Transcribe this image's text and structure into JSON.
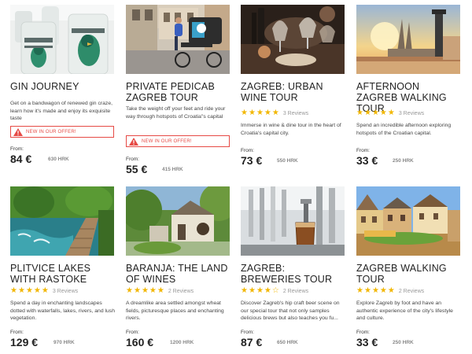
{
  "cards": [
    {
      "title": "GIN JOURNEY",
      "description": "Get on a bandwagon of renewed gin craze, learn how it's made and enjoy its exquisite taste",
      "badge": "NEW IN OUR OFFER!",
      "rating": 0,
      "reviews": "",
      "from_label": "From:",
      "price": "84 €",
      "old_price": "630 HRK",
      "image": "gin-bottles-photo"
    },
    {
      "title": "PRIVATE PEDICAB ZAGREB TOUR",
      "description": "Take the weight off your feet and ride your way through hotspots of Croatia\"s capital",
      "badge": "NEW IN OUR OFFER!",
      "rating": 0,
      "reviews": "",
      "from_label": "From:",
      "price": "55 €",
      "old_price": "415 HRK",
      "image": "pedicab-street-photo"
    },
    {
      "title": "ZAGREB: URBAN WINE TOUR",
      "description": "Immerse in wine & dine tour in the heart of Croatia's capital city.",
      "badge": "",
      "rating": 5,
      "reviews": "3 Reviews",
      "from_label": "From:",
      "price": "73 €",
      "old_price": "550 HRK",
      "image": "wine-glasses-photo"
    },
    {
      "title": "AFTERNOON ZAGREB WALKING TOUR",
      "description": "Spend an incredible afternoon exploring hotspots of the Croatian capital.",
      "badge": "",
      "rating": 5,
      "reviews": "3 Reviews",
      "from_label": "From:",
      "price": "33 €",
      "old_price": "250 HRK",
      "image": "zagreb-sunset-photo"
    },
    {
      "title": "PLITVICE LAKES WITH RASTOKE",
      "description": "Spend a day in enchanting landscapes dotted with waterfalls, lakes, rivers, and lush vegetation.",
      "badge": "",
      "rating": 5,
      "reviews": "3 Reviews",
      "from_label": "From:",
      "price": "129 €",
      "old_price": "970 HRK",
      "image": "plitvice-boardwalk-photo"
    },
    {
      "title": "BARANJA: THE LAND OF WINES",
      "description": "A dreamlike area settled amongst wheat fields, picturesque places and enchanting rivers.",
      "badge": "",
      "rating": 5,
      "reviews": "2 Reviews",
      "from_label": "From:",
      "price": "160 €",
      "old_price": "1200 HRK",
      "image": "baranja-cellar-photo"
    },
    {
      "title": "ZAGREB: BREWERIES TOUR",
      "description": "Discover Zagreb's hip craft beer scene on our special tour that not only samples delicious brews but also teaches you fu...",
      "badge": "",
      "rating": 4,
      "reviews": "2 Reviews",
      "from_label": "From:",
      "price": "87 €",
      "old_price": "650 HRK",
      "image": "beer-taps-photo"
    },
    {
      "title": "ZAGREB WALKING TOUR",
      "description": "Explore Zagreb by foot and have an authentic experience of the city's lifestyle and culture.",
      "badge": "",
      "rating": 5,
      "reviews": "2 Reviews",
      "from_label": "From:",
      "price": "33 €",
      "old_price": "250 HRK",
      "image": "zagreb-square-photo"
    }
  ],
  "colors": {
    "star": "#f2b701",
    "badge": "#e64a45"
  }
}
